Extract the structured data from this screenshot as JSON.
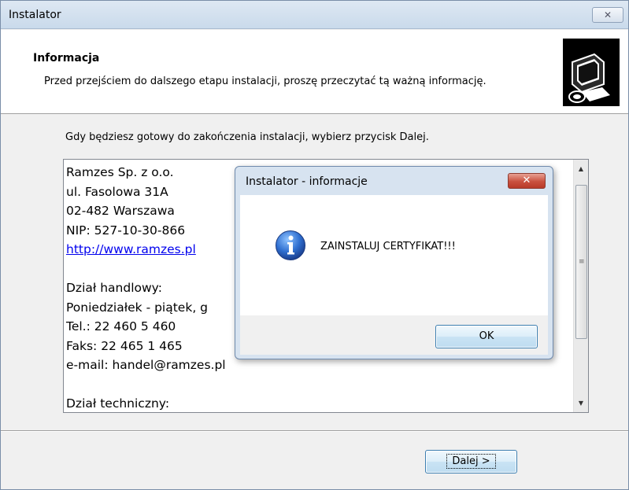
{
  "window": {
    "title": "Instalator",
    "close_glyph": "✕"
  },
  "header": {
    "title": "Informacja",
    "description": "Przed przejściem do dalszego etapu instalacji, proszę przeczytać tą ważną informację.",
    "icon": "computer-setup-icon"
  },
  "main": {
    "instruction": "Gdy będziesz gotowy do zakończenia instalacji, wybierz przycisk Dalej.",
    "info_lines": [
      "Ramzes Sp. z o.o.",
      "ul. Fasolowa 31A",
      "02-482 Warszawa",
      "NIP: 527-10-30-866",
      "http://www.ramzes.pl",
      "",
      "Dział handlowy:",
      "Poniedziałek - piątek, g",
      "Tel.: 22 460 5 460",
      "Faks: 22 465 1 465",
      "e-mail: handel@ramzes.pl",
      "",
      "Dział techniczny:"
    ]
  },
  "footer": {
    "next_label": "Dalej >"
  },
  "dialog": {
    "title": "Instalator - informacje",
    "close_glyph": "✕",
    "message": "ZAINSTALUJ CERTYFIKAT!!!",
    "ok_label": "OK",
    "icon": "information-icon"
  },
  "colors": {
    "accent": "#3c7fb1",
    "dialog_frame": "#d7e3f0",
    "close_red": "#c9503e",
    "link": "#0000ee"
  }
}
